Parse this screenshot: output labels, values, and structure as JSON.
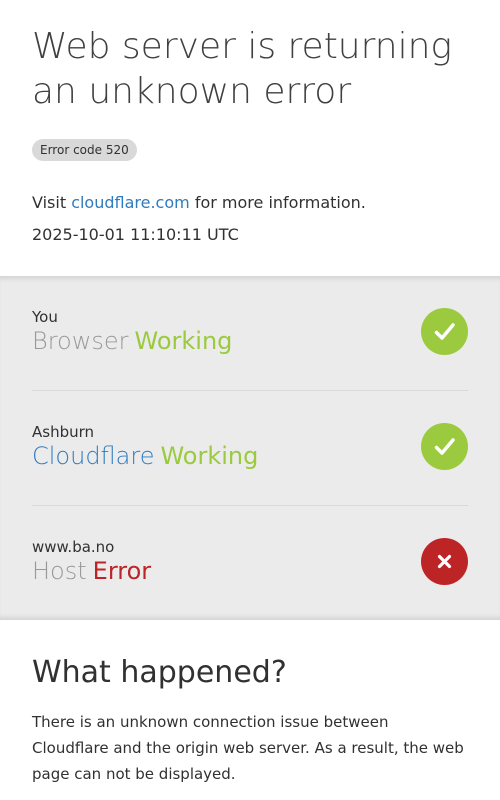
{
  "header": {
    "title": "Web server is returning an unknown error",
    "error_code": "Error code 520",
    "visit_prefix": "Visit ",
    "visit_link": "cloudflare.com",
    "visit_suffix": " for more information.",
    "timestamp": "2025-10-01 11:10:11 UTC"
  },
  "status": [
    {
      "location": "You",
      "name": "Browser",
      "state": "Working",
      "icon": "checkmark-icon"
    },
    {
      "location": "Ashburn",
      "name": "Cloudflare",
      "state": "Working",
      "icon": "checkmark-icon"
    },
    {
      "location": "www.ba.no",
      "name": "Host",
      "state": "Error",
      "icon": "cross-icon"
    }
  ],
  "what_happened": {
    "heading": "What happened?",
    "body": "There is an unknown connection issue between Cloudflare and the origin web server. As a result, the web page can not be displayed."
  },
  "colors": {
    "working": "#9bca3e",
    "error": "#bd2426",
    "link": "#2f7bbf"
  }
}
